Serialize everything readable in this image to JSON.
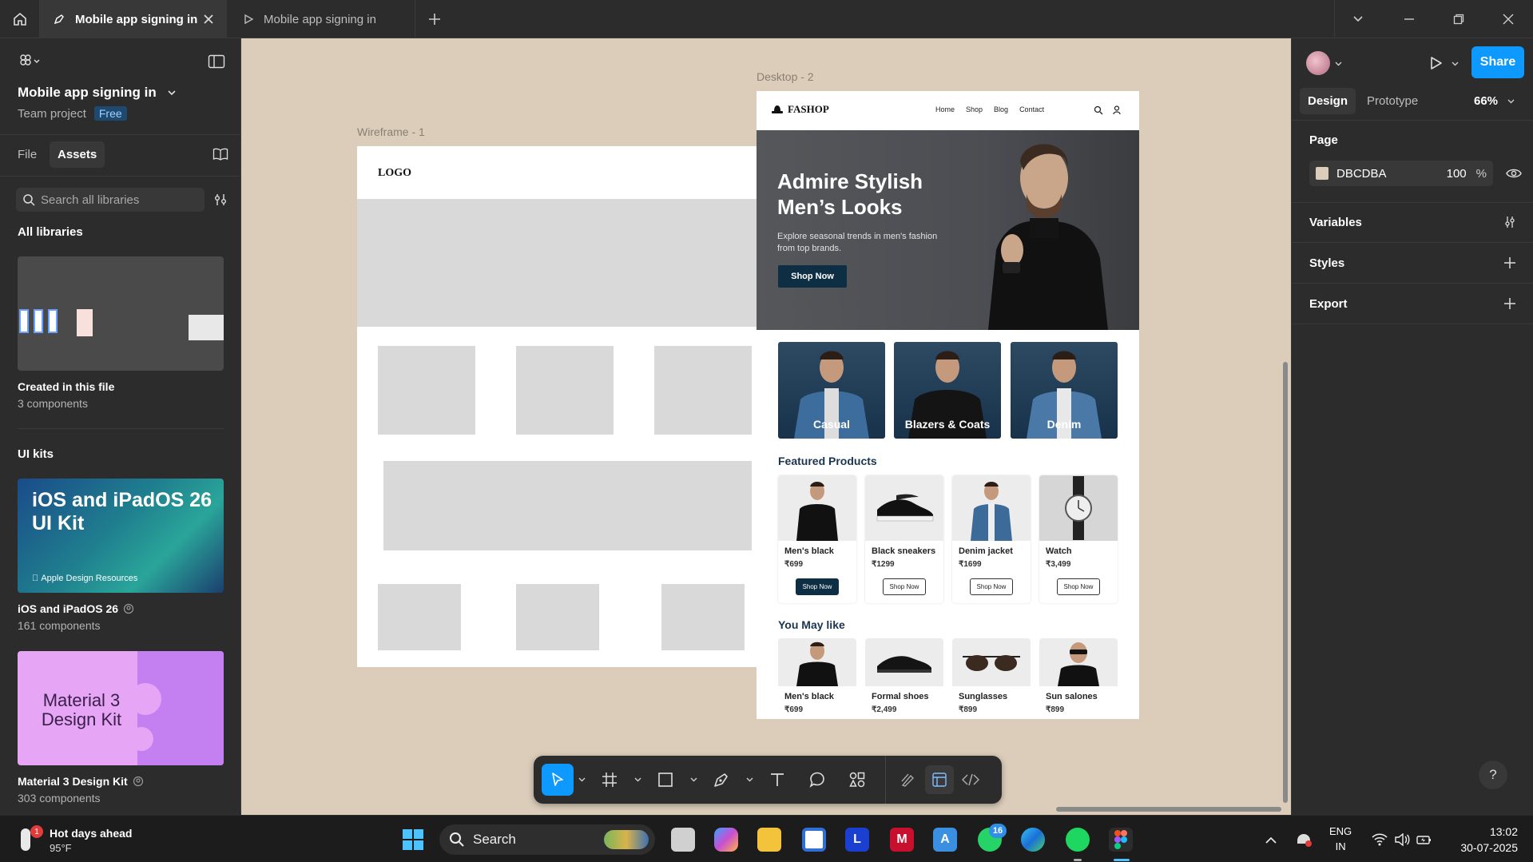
{
  "tabs": [
    {
      "label": "Mobile app signing in",
      "active": true
    },
    {
      "label": "Mobile app signing in",
      "active": false
    }
  ],
  "file": {
    "name": "Mobile app signing in",
    "project": "Team project",
    "plan": "Free"
  },
  "left_tabs": {
    "file": "File",
    "assets": "Assets"
  },
  "search": {
    "placeholder": "Search all libraries"
  },
  "libraries": {
    "heading": "All libraries",
    "created": {
      "title": "Created in this file",
      "count": "3 components"
    },
    "uikits_heading": "UI kits",
    "ios": {
      "title": "iOS and iPadOS 26",
      "count": "161 components",
      "thumb_title": "iOS and iPadOS 26 UI Kit",
      "thumb_brand": "Apple Design Resources"
    },
    "material": {
      "title": "Material 3 Design Kit",
      "count": "303 components",
      "thumb_title": "Material 3 Design Kit"
    }
  },
  "canvas": {
    "background": "#DBCDBA",
    "wireframe": {
      "label": "Wireframe - 1",
      "logo": "LOGO"
    },
    "desktop": {
      "label": "Desktop - 2",
      "brand": "FASHOP",
      "nav": [
        "Home",
        "Shop",
        "Blog",
        "Contact"
      ],
      "hero_title_1": "Admire Stylish",
      "hero_title_2": "Men’s Looks",
      "hero_sub_1": "Explore seasonal trends in men's fashion",
      "hero_sub_2": "from top brands.",
      "hero_button": "Shop Now",
      "categories": [
        "Casual",
        "Blazers & Coats",
        "Denim"
      ],
      "featured_heading": "Featured Products",
      "featured": [
        {
          "name": "Men's black",
          "price": "₹699",
          "button": "Shop Now"
        },
        {
          "name": "Black sneakers",
          "price": "₹1299",
          "button": "Shop Now"
        },
        {
          "name": "Denim jacket",
          "price": "₹1699",
          "button": "Shop Now"
        },
        {
          "name": "Watch",
          "price": "₹3,499",
          "button": "Shop Now"
        }
      ],
      "maylike_heading": "You May like",
      "maylike": [
        {
          "name": "Men's black",
          "price": "₹699"
        },
        {
          "name": "Formal shoes",
          "price": "₹2,499"
        },
        {
          "name": "Sunglasses",
          "price": "₹899"
        },
        {
          "name": "Sun salones",
          "price": "₹899"
        }
      ]
    }
  },
  "right": {
    "tabs": {
      "design": "Design",
      "prototype": "Prototype"
    },
    "zoom": "66%",
    "share": "Share",
    "page_heading": "Page",
    "page_color": "DBCDBA",
    "page_opacity": "100",
    "percent": "%",
    "sections": [
      "Variables",
      "Styles",
      "Export"
    ]
  },
  "taskbar": {
    "weather_title": "Hot days ahead",
    "weather_temp": "95°F",
    "weather_badge": "1",
    "search": "Search",
    "whatsapp_badge": "16",
    "lang_1": "ENG",
    "lang_2": "IN",
    "time": "13:02",
    "date": "30-07-2025"
  },
  "colors": {
    "accent": "#0d99ff",
    "canvas": "#dbcdba",
    "dark_navy": "#0e2e44"
  }
}
